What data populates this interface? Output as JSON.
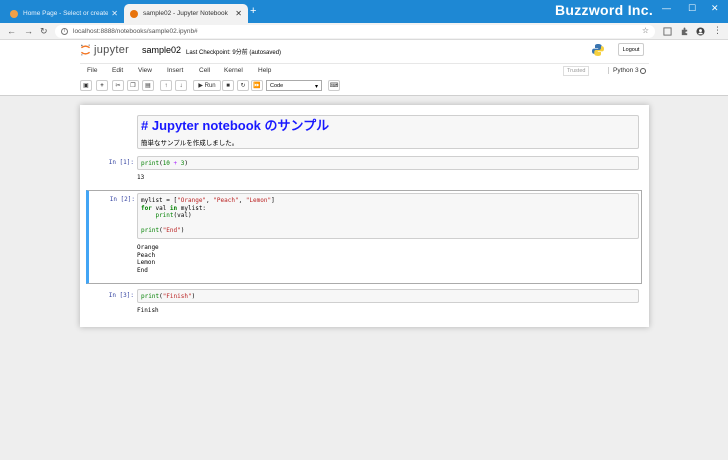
{
  "browser": {
    "tabs": [
      {
        "title": "Home Page - Select or create a n",
        "active": false
      },
      {
        "title": "sample02 - Jupyter Notebook",
        "active": true
      }
    ],
    "new_tab": "+",
    "brand": "Buzzword Inc.",
    "url": "localhost:8888/notebooks/sample02.ipynb#",
    "window_controls": {
      "minimize": "—",
      "maximize": "☐",
      "close": "✕"
    }
  },
  "jupyter": {
    "logo_text": "jupyter",
    "notebook_name": "sample02",
    "checkpoint": "Last Checkpoint: 9分前  (autosaved)",
    "logout_label": "Logout",
    "menu": [
      "File",
      "Edit",
      "View",
      "Insert",
      "Cell",
      "Kernel",
      "Help"
    ],
    "trusted_label": "Trusted",
    "kernel_name": "Python 3",
    "toolbar": {
      "run_label": "Run",
      "cell_type": "Code"
    }
  },
  "cells": [
    {
      "type": "markdown",
      "title": "# Jupyter notebook のサンプル",
      "text": "簡単なサンプルを作成しました。"
    },
    {
      "type": "code",
      "prompt": "In [1]:",
      "output": "13"
    },
    {
      "type": "code",
      "prompt": "In [2]:",
      "output": "Orange\nPeach\nLemon\nEnd"
    },
    {
      "type": "code",
      "prompt": "In [3]:",
      "output": "Finish"
    }
  ],
  "code": {
    "c1": {
      "fn": "print",
      "open": "(",
      "a": "10",
      "op": "+",
      "b": "3",
      "close": ")"
    },
    "c2": {
      "var": "mylist",
      "eq": " = [",
      "s1": "\"Orange\"",
      "s2": "\"Peach\"",
      "s3": "\"Lemon\"",
      "end": "]",
      "for": "for",
      "loopvar": " val ",
      "in": "in",
      "iter": " mylist:",
      "fn": "print",
      "arg": "(val)",
      "fn2": "print",
      "s4": "\"End\""
    },
    "c3": {
      "fn": "print",
      "s": "\"Finish\""
    }
  }
}
